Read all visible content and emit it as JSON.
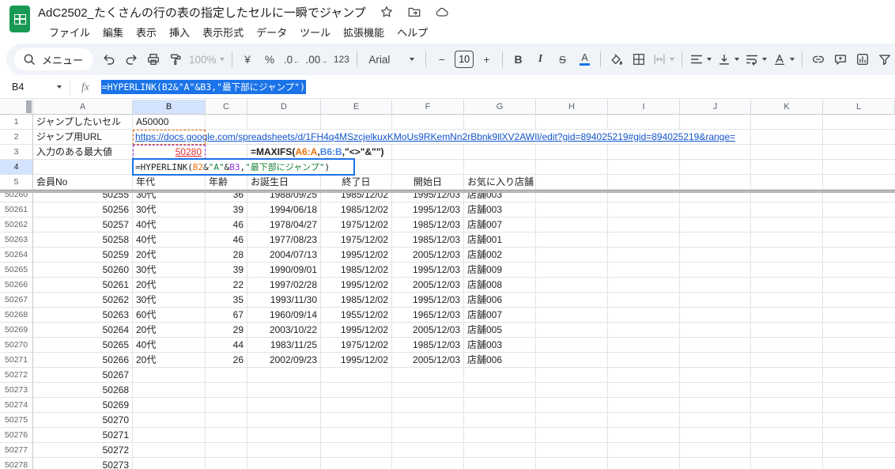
{
  "titlebar": {
    "title": "AdC2502_たくさんの行の表の指定したセルに一瞬でジャンプ"
  },
  "menubar": {
    "items": [
      "ファイル",
      "編集",
      "表示",
      "挿入",
      "表示形式",
      "データ",
      "ツール",
      "拡張機能",
      "ヘルプ"
    ]
  },
  "toolbar": {
    "menu_pill": "メニュー",
    "zoom": "100%",
    "currency": "¥",
    "percent": "%",
    "dec_dec": ".0",
    "dec_dec_arrow": "←",
    "dec_inc": ".00",
    "dec_inc_arrow": "→",
    "format_123": "123",
    "font_family": "Arial",
    "minus": "−",
    "font_size": "10",
    "plus": "+",
    "bold": "B",
    "italic": "I",
    "strike": "S",
    "text_color": "A"
  },
  "formula_bar": {
    "cell_ref": "B4",
    "fx": "fx",
    "formula": "=HYPERLINK(B2&\"A\"&B3,\"最下部にジャンプ\")"
  },
  "grid": {
    "selection": {
      "cell": "B4",
      "column": "B",
      "row": "4"
    },
    "column_letters": [
      "A",
      "B",
      "C",
      "D",
      "E",
      "F",
      "G",
      "H",
      "I",
      "J",
      "K",
      "L"
    ],
    "frozen": {
      "row1": {
        "num": "1",
        "label": "ジャンプしたいセル",
        "value": "A50000"
      },
      "row2": {
        "num": "2",
        "label": "ジャンプ用URL",
        "url": "https://docs.google.com/spreadsheets/d/1FH4q4MSzcjelkuxKMoUs9RKemNn2rBbnk9llXV2AWIl/edit?gid=894025219#gid=894025219&range="
      },
      "row3": {
        "num": "3",
        "label": "入力のある最大値",
        "value": "50280",
        "formula_parts": [
          {
            "text": "=MAXIFS(",
            "color": "#202124"
          },
          {
            "text": "A6:A",
            "color": "#e8710a"
          },
          {
            "text": ",",
            "color": "#202124"
          },
          {
            "text": "B6:B",
            "color": "#4a86e8"
          },
          {
            "text": ",\"<>\"&\"\")",
            "color": "#202124"
          }
        ]
      },
      "row4": {
        "num": "4",
        "formula_parts": [
          {
            "text": "=HYPERLINK(",
            "color": "#202124"
          },
          {
            "text": "B2",
            "color": "#e8710a"
          },
          {
            "text": "&",
            "color": "#202124"
          },
          {
            "text": "\"A\"",
            "color": "#188038"
          },
          {
            "text": "&",
            "color": "#202124"
          },
          {
            "text": "B3",
            "color": "#9334e6"
          },
          {
            "text": ",",
            "color": "#202124"
          },
          {
            "text": "\"最下部にジャンプ\"",
            "color": "#188038"
          },
          {
            "text": ")",
            "color": "#202124"
          }
        ]
      },
      "row5": {
        "num": "5",
        "headers": [
          "会員No",
          "年代",
          "年齢",
          "お誕生日",
          "終了日",
          "開始日",
          "お気に入り店舗"
        ]
      }
    },
    "rows": [
      {
        "num": "50260",
        "partial": true,
        "cells": [
          "50255",
          "30代",
          "36",
          "1988/09/25",
          "1985/12/02",
          "1995/12/03",
          "店舗003"
        ]
      },
      {
        "num": "50261",
        "cells": [
          "50256",
          "30代",
          "39",
          "1994/06/18",
          "1985/12/02",
          "1995/12/03",
          "店舗003"
        ]
      },
      {
        "num": "50262",
        "cells": [
          "50257",
          "40代",
          "46",
          "1978/04/27",
          "1975/12/02",
          "1985/12/03",
          "店舗007"
        ]
      },
      {
        "num": "50263",
        "cells": [
          "50258",
          "40代",
          "46",
          "1977/08/23",
          "1975/12/02",
          "1985/12/03",
          "店舗001"
        ]
      },
      {
        "num": "50264",
        "cells": [
          "50259",
          "20代",
          "28",
          "2004/07/13",
          "1995/12/02",
          "2005/12/03",
          "店舗002"
        ]
      },
      {
        "num": "50265",
        "cells": [
          "50260",
          "30代",
          "39",
          "1990/09/01",
          "1985/12/02",
          "1995/12/03",
          "店舗009"
        ]
      },
      {
        "num": "50266",
        "cells": [
          "50261",
          "20代",
          "22",
          "1997/02/28",
          "1995/12/02",
          "2005/12/03",
          "店舗008"
        ]
      },
      {
        "num": "50267",
        "cells": [
          "50262",
          "30代",
          "35",
          "1993/11/30",
          "1985/12/02",
          "1995/12/03",
          "店舗006"
        ]
      },
      {
        "num": "50268",
        "cells": [
          "50263",
          "60代",
          "67",
          "1960/09/14",
          "1955/12/02",
          "1965/12/03",
          "店舗007"
        ]
      },
      {
        "num": "50269",
        "cells": [
          "50264",
          "20代",
          "29",
          "2003/10/22",
          "1995/12/02",
          "2005/12/03",
          "店舗005"
        ]
      },
      {
        "num": "50270",
        "cells": [
          "50265",
          "40代",
          "44",
          "1983/11/25",
          "1975/12/02",
          "1985/12/03",
          "店舗003"
        ]
      },
      {
        "num": "50271",
        "cells": [
          "50266",
          "20代",
          "26",
          "2002/09/23",
          "1995/12/02",
          "2005/12/03",
          "店舗006"
        ]
      },
      {
        "num": "50272",
        "cells": [
          "50267"
        ]
      },
      {
        "num": "50273",
        "cells": [
          "50268"
        ]
      },
      {
        "num": "50274",
        "cells": [
          "50269"
        ]
      },
      {
        "num": "50275",
        "cells": [
          "50270"
        ]
      },
      {
        "num": "50276",
        "cells": [
          "50271"
        ]
      },
      {
        "num": "50277",
        "cells": [
          "50272"
        ]
      },
      {
        "num": "50278",
        "cells": [
          "50273"
        ]
      }
    ]
  },
  "colors": {
    "accent_blue": "#1a73e8",
    "link_blue": "#1155cc",
    "red_value": "#e43030",
    "ref_orange": "#e8710a",
    "ref_purple": "#9334e6",
    "ref_green": "#188038",
    "ref_blue": "#4a86e8",
    "selected_header_bg": "#d3e3fd",
    "toolbar_bg": "#f0f4f9",
    "sheets_green": "#189a55"
  }
}
